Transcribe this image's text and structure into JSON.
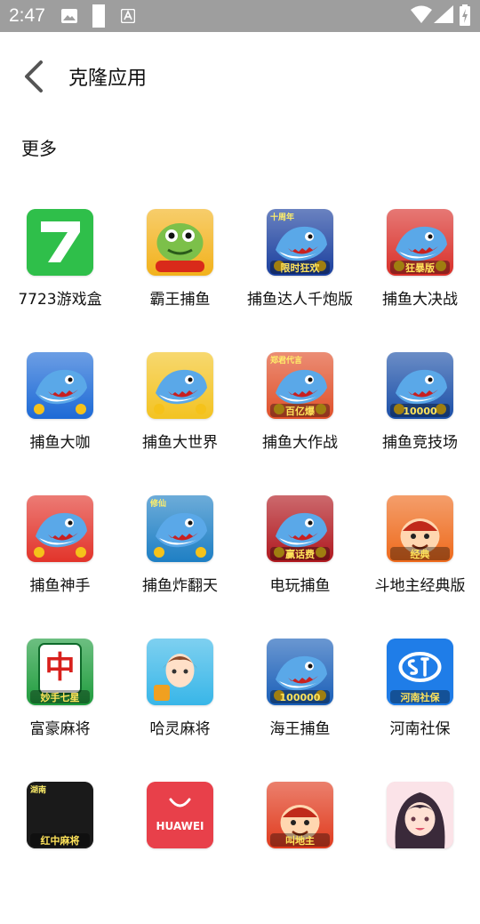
{
  "status_bar": {
    "time": "2:47",
    "icons": [
      "image-notification-icon",
      "sim-card-icon",
      "a-notification-icon",
      "wifi-icon",
      "cell-signal-icon",
      "battery-charging-icon"
    ]
  },
  "header": {
    "back_icon": "chevron-left-icon",
    "title": "克隆应用"
  },
  "section": {
    "title": "更多"
  },
  "apps": [
    {
      "label": "7723游戏盒",
      "icon": "7723-game-box-icon",
      "color": "#2fbf4a"
    },
    {
      "label": "霸王捕鱼",
      "icon": "bawang-fishing-icon",
      "color": "#f2b21c"
    },
    {
      "label": "捕鱼达人千炮版",
      "icon": "fishing-master-icon",
      "color": "#1a3f9e",
      "badge": "限时狂欢",
      "corner": "十周年"
    },
    {
      "label": "捕鱼大决战",
      "icon": "fishing-showdown-icon",
      "color": "#d9302a",
      "badge": "狂暴版"
    },
    {
      "label": "捕鱼大咖",
      "icon": "fishing-bigshot-icon",
      "color": "#1d6ad6"
    },
    {
      "label": "捕鱼大世界",
      "icon": "fishing-world-icon",
      "color": "#f3c322"
    },
    {
      "label": "捕鱼大作战",
      "icon": "fishing-battle-icon",
      "color": "#e0502a",
      "badge": "百亿爆",
      "corner": "郑君代言"
    },
    {
      "label": "捕鱼竞技场",
      "icon": "fishing-arena-icon",
      "color": "#1b4fa8",
      "badge": "10000"
    },
    {
      "label": "捕鱼神手",
      "icon": "fishing-godhand-icon",
      "color": "#e2342b"
    },
    {
      "label": "捕鱼炸翻天",
      "icon": "fishing-blast-icon",
      "color": "#1e7fc4",
      "corner": "修仙"
    },
    {
      "label": "电玩捕鱼",
      "icon": "arcade-fishing-icon",
      "color": "#b0181f",
      "badge": "赢话费"
    },
    {
      "label": "斗地主经典版",
      "icon": "doudizhu-classic-icon",
      "color": "#ee6a1c",
      "badge": "经典"
    },
    {
      "label": "富豪麻将",
      "icon": "rich-mahjong-icon",
      "color": "#1f9c3d",
      "badge": "妙手七星",
      "corner": "中"
    },
    {
      "label": "哈灵麻将",
      "icon": "haling-mahjong-icon",
      "color": "#38b6e8"
    },
    {
      "label": "海王捕鱼",
      "icon": "sea-king-fishing-icon",
      "color": "#1a5fb8",
      "badge": "100000"
    },
    {
      "label": "河南社保",
      "icon": "henan-social-security-icon",
      "color": "#1f7de8",
      "badge": "河南社保"
    },
    {
      "label": "",
      "icon": "hongzhong-mahjong-icon",
      "color": "#1a1a1a",
      "badge": "红中麻将",
      "corner": "湖南"
    },
    {
      "label": "",
      "icon": "huawei-appgallery-icon",
      "color": "#e8404a",
      "badge": "HUAWEI"
    },
    {
      "label": "",
      "icon": "jiaodizhu-icon",
      "color": "#e03b1e",
      "badge": "叫地主"
    },
    {
      "label": "",
      "icon": "anime-girl-icon",
      "color": "#f2a6b5"
    }
  ]
}
